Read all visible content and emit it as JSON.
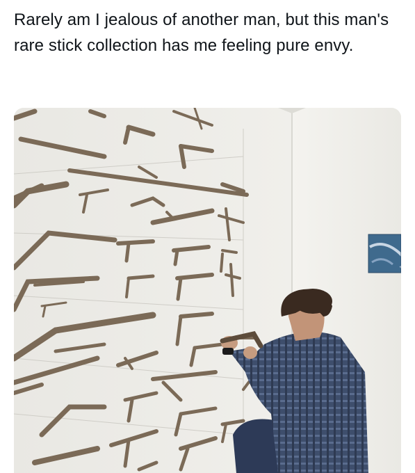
{
  "post": {
    "text": "Rarely am I jealous of another man, but this man's rare stick collection has me feeling pure envy."
  },
  "media": {
    "alt": "photo-stick-collection",
    "wall_color": "#eeede9",
    "stick_color": "#7a6a58",
    "shirt_color": "#3b4a66"
  }
}
